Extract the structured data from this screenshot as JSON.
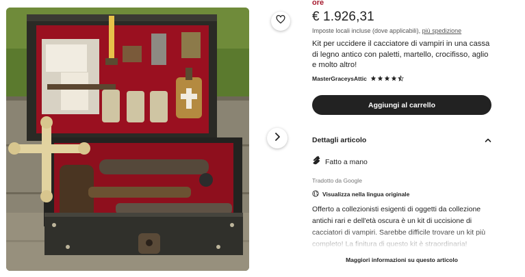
{
  "seller_tag": "ore",
  "price": "€ 1.926,31",
  "tax": {
    "text": "Imposte locali incluse (dove applicabili),",
    "shipping_link": "più spedizione"
  },
  "title": "Kit per uccidere il cacciatore di vampiri in una cassa di legno antico con paletti, martello, crocifisso, aglio e molto altro!",
  "shop": {
    "name": "MasterGraceysAttic",
    "rating": 4.5,
    "star_count": 5
  },
  "add_to_cart": "Aggiungi al carrello",
  "details": {
    "header": "Dettagli articolo",
    "handmade": "Fatto a mano",
    "translated_by": "Tradotto da Google",
    "view_original": "Visualizza nella lingua originale",
    "description": "Offerto a collezionisti esigenti di oggetti da collezione antichi rari e dell'età oscura è un kit di uccisione di cacciatori di vampiri. Sarebbe difficile trovare un kit più completo! La finitura di questo kit è straordinaria!",
    "more_info": "Maggiori informazioni su questo articolo"
  },
  "icons": {
    "favorite": "heart-icon",
    "next": "chevron-right-icon",
    "collapse": "chevron-up-icon",
    "handmade": "hand-icon",
    "translate": "globe-icon",
    "rating": "star-icon"
  },
  "colors": {
    "accent": "#a61a2e",
    "button": "#222222",
    "star": "#222222"
  }
}
